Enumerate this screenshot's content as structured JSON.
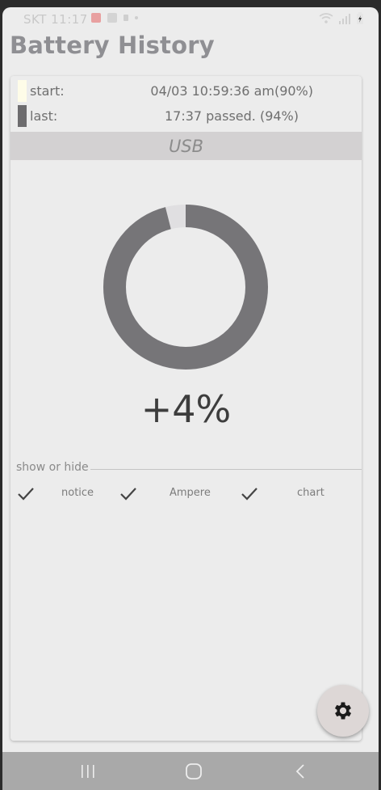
{
  "status_bar": {
    "carrier_time": "SKT 11:17",
    "icons": [
      "gallery-icon",
      "clipboard-icon",
      "notification-icon",
      "dot-icon",
      "wifi-icon",
      "signal-icon",
      "battery-charging-icon"
    ]
  },
  "app": {
    "title": "Battery History"
  },
  "info": {
    "start": {
      "label": "start:",
      "value": "04/03 10:59:36 am(90%)",
      "swatch_color": "#fefce8"
    },
    "last": {
      "label": "last:",
      "value": "17:37  passed. (94%)",
      "swatch_color": "#6d6c6e"
    },
    "source": "USB"
  },
  "gauge": {
    "percent_change": "+4%",
    "fill_fraction": 0.96,
    "track_color": "#e0dfe1",
    "fill_color": "#767578"
  },
  "options": {
    "section_label": "show or hide",
    "toggles": [
      {
        "label": "notice",
        "checked": true
      },
      {
        "label": "Ampere",
        "checked": true
      },
      {
        "label": "chart",
        "checked": true
      }
    ]
  },
  "fab": {
    "icon": "gear-icon"
  },
  "nav": {
    "items": [
      "recent-apps-icon",
      "home-icon",
      "back-icon"
    ]
  }
}
